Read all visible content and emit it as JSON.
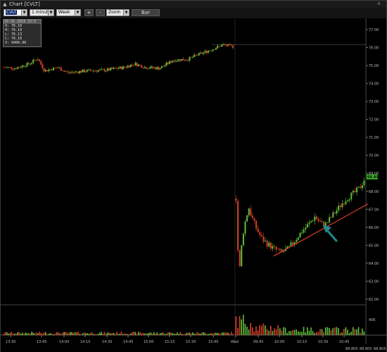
{
  "window": {
    "title": "Chart [CVLT]",
    "close_glyph": "x"
  },
  "toolbar": {
    "symbol": "CVLT",
    "interval": "1 minute",
    "period": "Week",
    "zoom_in": "+",
    "zoom_out": "-",
    "zoom": "Zoom",
    "bar_button": "Bar"
  },
  "info_box": {
    "header": "20.01.2014 15:5",
    "open": "O: 76.16",
    "high": "H: 76.19",
    "low": "L: 76.13",
    "close": "C: 76.16",
    "volume": "V: 9400.00"
  },
  "colors": {
    "up": "#5fbf3a",
    "down": "#d8402a",
    "trendline": "#e0402a",
    "arrow": "#1f8a8a",
    "last_price": "#3fbf2a"
  },
  "chart_data": {
    "type": "candlestick",
    "y_ticks": [
      "77.00",
      "76.00",
      "75.00",
      "74.00",
      "73.00",
      "72.00",
      "71.00",
      "70.00",
      "69.00",
      "68.00",
      "67.00",
      "66.00",
      "65.00",
      "64.00",
      "63.00",
      "62.00"
    ],
    "volume_tick": "40K",
    "x_ticks": [
      "13:30",
      "13:45",
      "14:00",
      "14:15",
      "14:30",
      "14:45",
      "15:00",
      "15:15",
      "15:30",
      "15:45",
      "Wed",
      "09:45",
      "10:00",
      "10:15",
      "10:30",
      "10:45"
    ],
    "last_price": "68.805",
    "footer_values": [
      "68.805",
      "68.805",
      "68.805"
    ],
    "prior_session": {
      "start": 74.9,
      "end": 76.15,
      "reference_line": 76.16
    },
    "current_session": {
      "open": 67.6,
      "low": 63.0,
      "high": 68.9,
      "close": 68.805
    },
    "trendline": {
      "from": 64.4,
      "to": 67.3
    },
    "annotation": "arrow-pointer"
  }
}
